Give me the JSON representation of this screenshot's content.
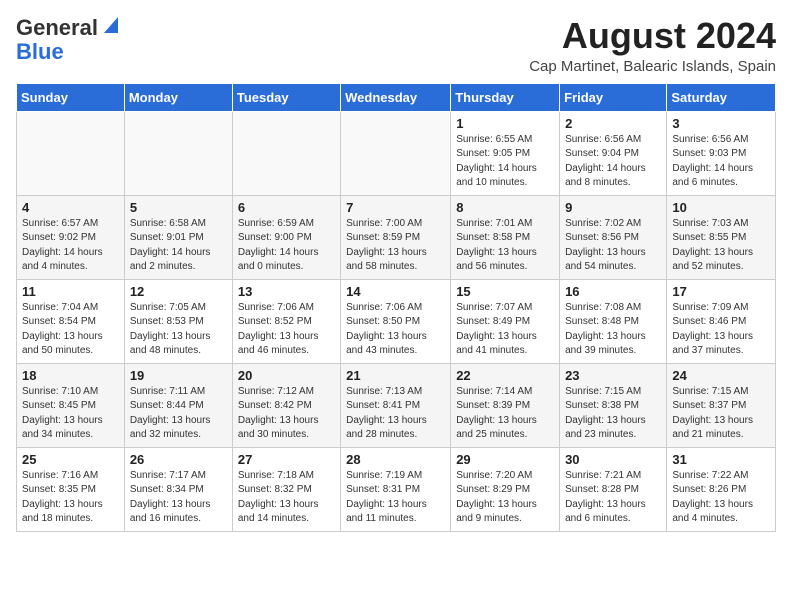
{
  "logo": {
    "general": "General",
    "blue": "Blue"
  },
  "title": "August 2024",
  "subtitle": "Cap Martinet, Balearic Islands, Spain",
  "days_of_week": [
    "Sunday",
    "Monday",
    "Tuesday",
    "Wednesday",
    "Thursday",
    "Friday",
    "Saturday"
  ],
  "weeks": [
    [
      {
        "day": "",
        "info": ""
      },
      {
        "day": "",
        "info": ""
      },
      {
        "day": "",
        "info": ""
      },
      {
        "day": "",
        "info": ""
      },
      {
        "day": "1",
        "info": "Sunrise: 6:55 AM\nSunset: 9:05 PM\nDaylight: 14 hours and 10 minutes."
      },
      {
        "day": "2",
        "info": "Sunrise: 6:56 AM\nSunset: 9:04 PM\nDaylight: 14 hours and 8 minutes."
      },
      {
        "day": "3",
        "info": "Sunrise: 6:56 AM\nSunset: 9:03 PM\nDaylight: 14 hours and 6 minutes."
      }
    ],
    [
      {
        "day": "4",
        "info": "Sunrise: 6:57 AM\nSunset: 9:02 PM\nDaylight: 14 hours and 4 minutes."
      },
      {
        "day": "5",
        "info": "Sunrise: 6:58 AM\nSunset: 9:01 PM\nDaylight: 14 hours and 2 minutes."
      },
      {
        "day": "6",
        "info": "Sunrise: 6:59 AM\nSunset: 9:00 PM\nDaylight: 14 hours and 0 minutes."
      },
      {
        "day": "7",
        "info": "Sunrise: 7:00 AM\nSunset: 8:59 PM\nDaylight: 13 hours and 58 minutes."
      },
      {
        "day": "8",
        "info": "Sunrise: 7:01 AM\nSunset: 8:58 PM\nDaylight: 13 hours and 56 minutes."
      },
      {
        "day": "9",
        "info": "Sunrise: 7:02 AM\nSunset: 8:56 PM\nDaylight: 13 hours and 54 minutes."
      },
      {
        "day": "10",
        "info": "Sunrise: 7:03 AM\nSunset: 8:55 PM\nDaylight: 13 hours and 52 minutes."
      }
    ],
    [
      {
        "day": "11",
        "info": "Sunrise: 7:04 AM\nSunset: 8:54 PM\nDaylight: 13 hours and 50 minutes."
      },
      {
        "day": "12",
        "info": "Sunrise: 7:05 AM\nSunset: 8:53 PM\nDaylight: 13 hours and 48 minutes."
      },
      {
        "day": "13",
        "info": "Sunrise: 7:06 AM\nSunset: 8:52 PM\nDaylight: 13 hours and 46 minutes."
      },
      {
        "day": "14",
        "info": "Sunrise: 7:06 AM\nSunset: 8:50 PM\nDaylight: 13 hours and 43 minutes."
      },
      {
        "day": "15",
        "info": "Sunrise: 7:07 AM\nSunset: 8:49 PM\nDaylight: 13 hours and 41 minutes."
      },
      {
        "day": "16",
        "info": "Sunrise: 7:08 AM\nSunset: 8:48 PM\nDaylight: 13 hours and 39 minutes."
      },
      {
        "day": "17",
        "info": "Sunrise: 7:09 AM\nSunset: 8:46 PM\nDaylight: 13 hours and 37 minutes."
      }
    ],
    [
      {
        "day": "18",
        "info": "Sunrise: 7:10 AM\nSunset: 8:45 PM\nDaylight: 13 hours and 34 minutes."
      },
      {
        "day": "19",
        "info": "Sunrise: 7:11 AM\nSunset: 8:44 PM\nDaylight: 13 hours and 32 minutes."
      },
      {
        "day": "20",
        "info": "Sunrise: 7:12 AM\nSunset: 8:42 PM\nDaylight: 13 hours and 30 minutes."
      },
      {
        "day": "21",
        "info": "Sunrise: 7:13 AM\nSunset: 8:41 PM\nDaylight: 13 hours and 28 minutes."
      },
      {
        "day": "22",
        "info": "Sunrise: 7:14 AM\nSunset: 8:39 PM\nDaylight: 13 hours and 25 minutes."
      },
      {
        "day": "23",
        "info": "Sunrise: 7:15 AM\nSunset: 8:38 PM\nDaylight: 13 hours and 23 minutes."
      },
      {
        "day": "24",
        "info": "Sunrise: 7:15 AM\nSunset: 8:37 PM\nDaylight: 13 hours and 21 minutes."
      }
    ],
    [
      {
        "day": "25",
        "info": "Sunrise: 7:16 AM\nSunset: 8:35 PM\nDaylight: 13 hours and 18 minutes."
      },
      {
        "day": "26",
        "info": "Sunrise: 7:17 AM\nSunset: 8:34 PM\nDaylight: 13 hours and 16 minutes."
      },
      {
        "day": "27",
        "info": "Sunrise: 7:18 AM\nSunset: 8:32 PM\nDaylight: 13 hours and 14 minutes."
      },
      {
        "day": "28",
        "info": "Sunrise: 7:19 AM\nSunset: 8:31 PM\nDaylight: 13 hours and 11 minutes."
      },
      {
        "day": "29",
        "info": "Sunrise: 7:20 AM\nSunset: 8:29 PM\nDaylight: 13 hours and 9 minutes."
      },
      {
        "day": "30",
        "info": "Sunrise: 7:21 AM\nSunset: 8:28 PM\nDaylight: 13 hours and 6 minutes."
      },
      {
        "day": "31",
        "info": "Sunrise: 7:22 AM\nSunset: 8:26 PM\nDaylight: 13 hours and 4 minutes."
      }
    ]
  ]
}
